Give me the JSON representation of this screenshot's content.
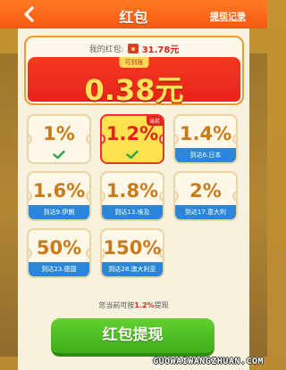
{
  "header": {
    "title": "红包",
    "record_link": "提现记录",
    "back_icon": "chevron-left-icon"
  },
  "balance": {
    "label": "我的红包:",
    "amount": "31.78元",
    "withdrawable_tag": "可到账",
    "withdrawable_amount": "0.38元"
  },
  "tiles": [
    {
      "rate": "1%",
      "status": "unlocked",
      "footer": ""
    },
    {
      "rate": "1.2%",
      "status": "current",
      "footer": "",
      "tag": "当前"
    },
    {
      "rate": "1.4%",
      "status": "locked",
      "footer": "到达6.日本"
    },
    {
      "rate": "1.6%",
      "status": "locked",
      "footer": "到达9.伊朗"
    },
    {
      "rate": "1.8%",
      "status": "locked",
      "footer": "到达13.埃及"
    },
    {
      "rate": "2%",
      "status": "locked",
      "footer": "到达17.意大利"
    },
    {
      "rate": "50%",
      "status": "locked",
      "footer": "到达23.德国"
    },
    {
      "rate": "150%",
      "status": "locked",
      "footer": "到达28.澳大利亚"
    }
  ],
  "hint": {
    "prefix": "您当前可按",
    "rate": "1.2%",
    "suffix": "提现"
  },
  "withdraw_button": "红包提现",
  "watermark": "GUOWAIWANGZHUAN.COM",
  "colors": {
    "header": "#f55a14",
    "accent_red": "#e3231b",
    "tile_footer": "#2a86d6",
    "button_green": "#3fae1a"
  }
}
